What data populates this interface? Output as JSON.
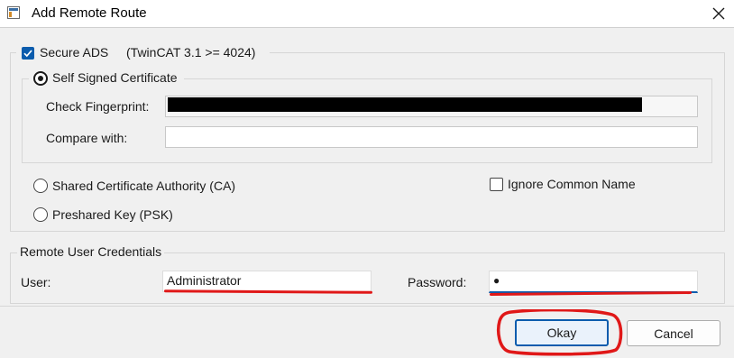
{
  "window": {
    "title": "Add Remote Route"
  },
  "secure_ads": {
    "checkbox_label": "Secure ADS",
    "checked": true,
    "version_note": "(TwinCAT 3.1 >= 4024)"
  },
  "self_signed": {
    "radio_label": "Self Signed Certificate",
    "selected": true,
    "check_fingerprint_label": "Check Fingerprint:",
    "compare_with_label": "Compare with:",
    "compare_with_value": ""
  },
  "shared_ca": {
    "radio_label": "Shared Certificate Authority (CA)",
    "selected": false
  },
  "psk": {
    "radio_label": "Preshared Key (PSK)",
    "selected": false
  },
  "ignore_common_name": {
    "label": "Ignore Common Name",
    "checked": false
  },
  "credentials": {
    "legend": "Remote User Credentials",
    "user_label": "User:",
    "user_value": "Administrator",
    "password_label": "Password:",
    "password_value": "●"
  },
  "buttons": {
    "okay": "Okay",
    "cancel": "Cancel"
  },
  "icons": {
    "close": "close-icon",
    "check": "checkmark-icon",
    "app": "window-app-icon"
  },
  "colors": {
    "accent": "#0b5cad",
    "annotation": "#e01818"
  }
}
